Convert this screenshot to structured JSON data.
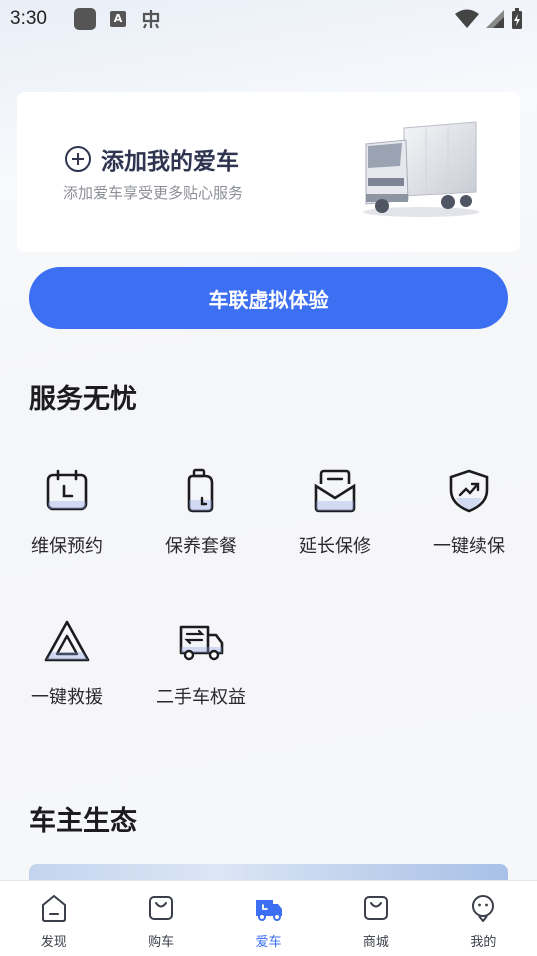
{
  "status_bar": {
    "time": "3:30",
    "icons": [
      "square-icon",
      "a-icon",
      "bug-icon",
      "wifi-icon",
      "signal-icon",
      "battery-icon"
    ]
  },
  "car_card": {
    "title": "添加我的爱车",
    "subtitle": "添加爱车享受更多贴心服务"
  },
  "cta": {
    "label": "车联虚拟体验"
  },
  "services": {
    "title": "服务无忧",
    "items": [
      {
        "label": "维保预约",
        "icon": "calendar-icon"
      },
      {
        "label": "保养套餐",
        "icon": "oil-can-icon"
      },
      {
        "label": "延长保修",
        "icon": "mail-box-icon"
      },
      {
        "label": "一键续保",
        "icon": "shield-trend-icon"
      },
      {
        "label": "一键救援",
        "icon": "warning-triangle-icon"
      },
      {
        "label": "二手车权益",
        "icon": "exchange-truck-icon"
      }
    ]
  },
  "ecology": {
    "title": "车主生态"
  },
  "tab_bar": {
    "items": [
      {
        "label": "发现",
        "icon": "discover-icon",
        "active": false
      },
      {
        "label": "购车",
        "icon": "bag-icon",
        "active": false
      },
      {
        "label": "爱车",
        "icon": "truck-icon",
        "active": true
      },
      {
        "label": "商城",
        "icon": "store-icon",
        "active": false
      },
      {
        "label": "我的",
        "icon": "profile-icon",
        "active": false
      }
    ]
  },
  "colors": {
    "accent": "#3d6ff2",
    "title_dark": "#2f3550",
    "muted": "#8c8f96"
  }
}
